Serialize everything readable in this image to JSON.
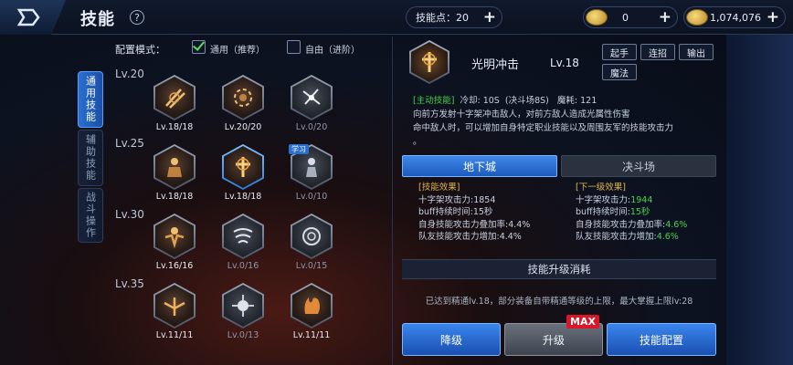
{
  "header": {
    "title": "技能",
    "help": "?"
  },
  "resources": {
    "skill_points_label": "技能点：",
    "skill_points": "20",
    "currency1": "0",
    "currency2": "1,074,076",
    "plus": "+"
  },
  "side_tabs": [
    "通用技能",
    "辅助技能",
    "战斗操作"
  ],
  "config": {
    "label": "配置模式：",
    "option1": "通用（推荐）",
    "option2": "自由（进阶）"
  },
  "level_rows": [
    "Lv.20",
    "Lv.25",
    "Lv.30",
    "Lv.35"
  ],
  "skills": [
    {
      "lv": "Lv.18/18",
      "icon": "sword-slash-icon",
      "dim": false
    },
    {
      "lv": "Lv.20/20",
      "icon": "chain-whirl-icon",
      "dim": false
    },
    {
      "lv": "Lv.0/20",
      "icon": "lightning-strike-icon",
      "dim": true
    },
    {
      "lv": "Lv.18/18",
      "icon": "armored-warrior-icon",
      "dim": false
    },
    {
      "lv": "Lv.18/18",
      "icon": "holy-cross-icon",
      "dim": false,
      "selected": true
    },
    {
      "lv": "Lv.0/10",
      "icon": "spirit-figure-icon",
      "dim": true,
      "learn": "学习"
    },
    {
      "lv": "Lv.16/16",
      "icon": "fist-warrior-icon",
      "dim": false
    },
    {
      "lv": "Lv.0/16",
      "icon": "whirlwind-icon",
      "dim": true
    },
    {
      "lv": "Lv.0/15",
      "icon": "ring-rune-icon",
      "dim": true
    },
    {
      "lv": "Lv.11/11",
      "icon": "winged-burst-icon",
      "dim": false
    },
    {
      "lv": "Lv.0/13",
      "icon": "radiant-orb-icon",
      "dim": true
    },
    {
      "lv": "Lv.11/11",
      "icon": "flame-palm-icon",
      "dim": false
    }
  ],
  "detail": {
    "name": "光明冲击",
    "level": "Lv.18",
    "tags": [
      "起手",
      "连招",
      "输出",
      "魔法"
    ],
    "active_tag": "[主动技能]",
    "cooldown": "冷却: 10S",
    "arena": "(决斗场8S)",
    "mana": "魔耗: 121",
    "desc1": "向前方发射十字架冲击敌人，对前方敌人造成光属性伤害",
    "desc2": "命中敌人时，可以增加自身特定职业技能以及周围友军的技能攻击力",
    "desc3": "。"
  },
  "modes": {
    "dungeon": "地下城",
    "arena": "决斗场"
  },
  "effects": {
    "current_head": "[技能效果]",
    "next_head": "[下一级效果]",
    "current": [
      {
        "k": "十字架攻击力:",
        "v": "1854"
      },
      {
        "k": "buff持续时间:",
        "v": "15秒"
      },
      {
        "k": "自身技能攻击力叠加率:",
        "v": "4.4%"
      },
      {
        "k": "队友技能攻击力增加:",
        "v": "4.4%"
      }
    ],
    "next": [
      {
        "k": "十字架攻击力:",
        "v": "1944"
      },
      {
        "k": "buff持续时间:",
        "v": "15秒"
      },
      {
        "k": "自身技能攻击力叠加率:",
        "v": "4.6%"
      },
      {
        "k": "队友技能攻击力增加:",
        "v": "4.6%"
      }
    ]
  },
  "cost": {
    "head": "技能升级消耗",
    "text": "已达到精通lv.18，部分装备自带精通等级的上限，最大掌握上限lv:28"
  },
  "buttons": {
    "downgrade": "降级",
    "upgrade": "升级",
    "max": "MAX",
    "config": "技能配置"
  },
  "colors": {
    "accent_blue": "#2a6fd0",
    "active_green": "#46d04a",
    "effect_gold": "#e0b54a",
    "max_red": "#d8182a"
  }
}
